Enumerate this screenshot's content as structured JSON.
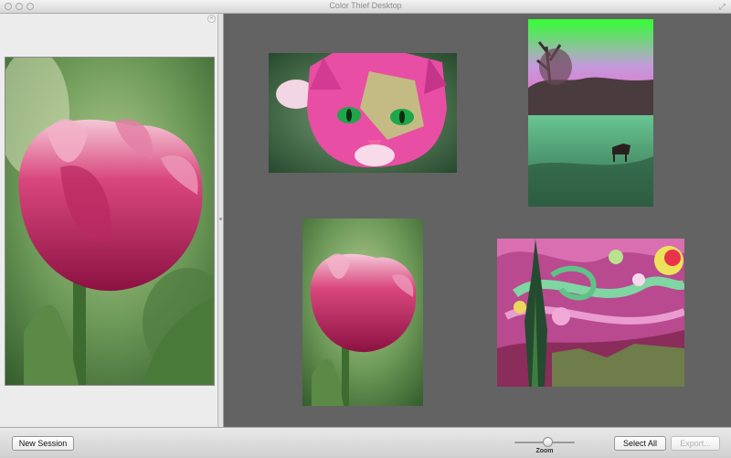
{
  "window": {
    "title": "Color Thief Desktop"
  },
  "preview": {
    "image": "pink tulip close-up photo"
  },
  "canvas": {
    "images": [
      {
        "label": "kitten photo"
      },
      {
        "label": "landscape with horse photo"
      },
      {
        "label": "pink tulip photo"
      },
      {
        "label": "Starry Night painting"
      }
    ]
  },
  "toolbar": {
    "new_session_label": "New Session",
    "zoom_label": "Zoom",
    "zoom_level": 0.55,
    "select_all_label": "Select All",
    "export_label": "Export..."
  },
  "colors": {
    "canvas_bg": "#636363",
    "sidebar_bg": "#ececec"
  }
}
